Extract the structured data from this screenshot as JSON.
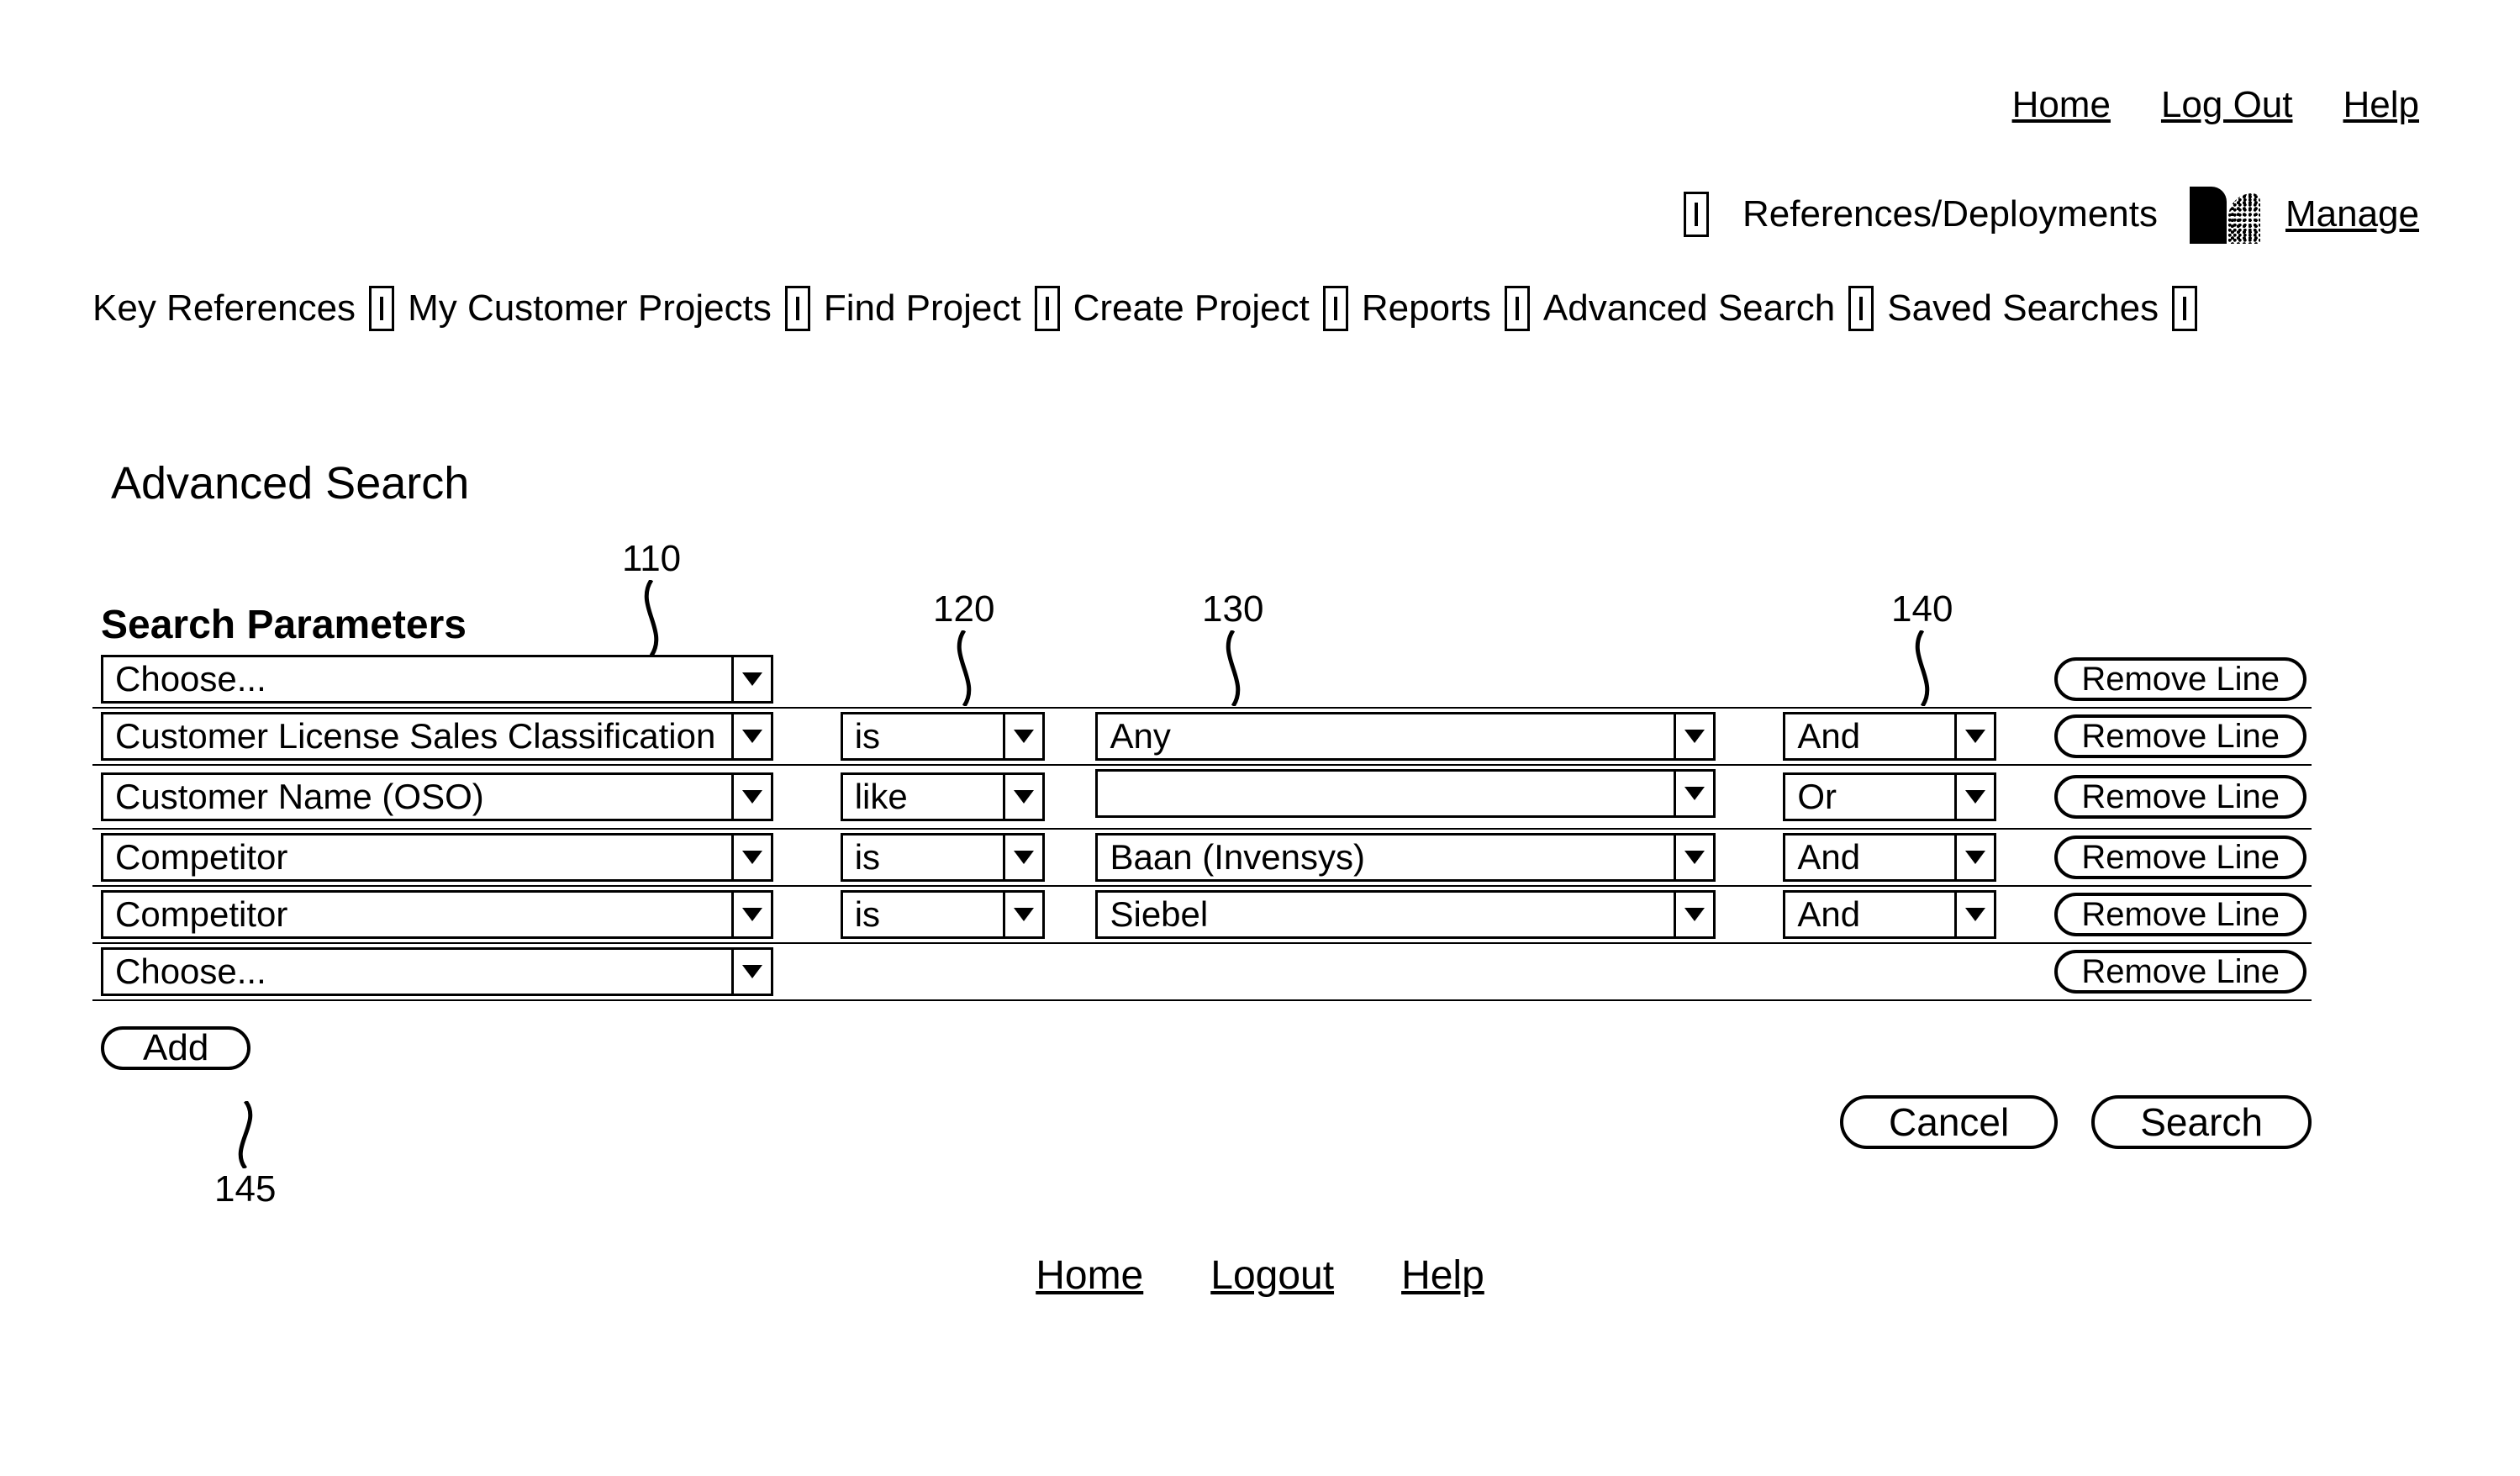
{
  "top_links": {
    "home": "Home",
    "logout": "Log Out",
    "help": "Help"
  },
  "secondary": {
    "refdep": "References/Deployments",
    "manage": "Manage"
  },
  "nav": {
    "items": [
      "Key References",
      "My Customer Projects",
      "Find Project",
      "Create Project",
      "Reports",
      "Advanced Search",
      "Saved Searches"
    ]
  },
  "page": {
    "title": "Advanced Search",
    "sp_heading": "Search Parameters"
  },
  "callouts": {
    "c110": "110",
    "c120": "120",
    "c130": "130",
    "c140": "140",
    "c145": "145"
  },
  "rows": [
    {
      "field": "Choose...",
      "op": "",
      "val": "",
      "join": "",
      "remove": "Remove Line",
      "full": false
    },
    {
      "field": "Customer License Sales Classification",
      "op": "is",
      "val": "Any",
      "join": "And",
      "remove": "Remove Line",
      "full": true
    },
    {
      "field": "Customer Name (OSO)",
      "op": "like",
      "val": "",
      "join": "Or",
      "remove": "Remove Line",
      "full": true
    },
    {
      "field": "Competitor",
      "op": "is",
      "val": "Baan (Invensys)",
      "join": "And",
      "remove": "Remove Line",
      "full": true
    },
    {
      "field": "Competitor",
      "op": "is",
      "val": "Siebel",
      "join": "And",
      "remove": "Remove Line",
      "full": true
    },
    {
      "field": "Choose...",
      "op": "",
      "val": "",
      "join": "",
      "remove": "Remove Line",
      "full": false
    }
  ],
  "buttons": {
    "add": "Add",
    "cancel": "Cancel",
    "search": "Search"
  },
  "footer": {
    "home": "Home",
    "logout": "Logout",
    "help": "Help"
  }
}
